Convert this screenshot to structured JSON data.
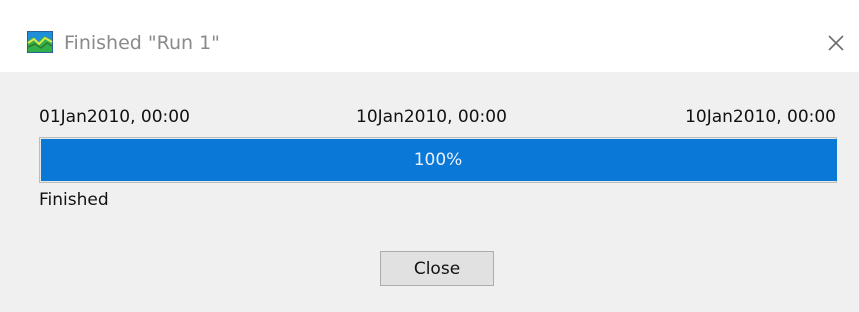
{
  "window": {
    "title": "Finished \"Run 1\"",
    "app_icon": "chart-area-icon",
    "close_icon": "close-icon"
  },
  "timeline": {
    "start_label": "01Jan2010, 00:00",
    "current_label": "10Jan2010, 00:00",
    "end_label": "10Jan2010, 00:00"
  },
  "progress": {
    "percent_text": "100%",
    "fraction": 1.0,
    "fill_color": "#0a78d7"
  },
  "status": {
    "text": "Finished"
  },
  "buttons": {
    "close_label": "Close"
  }
}
